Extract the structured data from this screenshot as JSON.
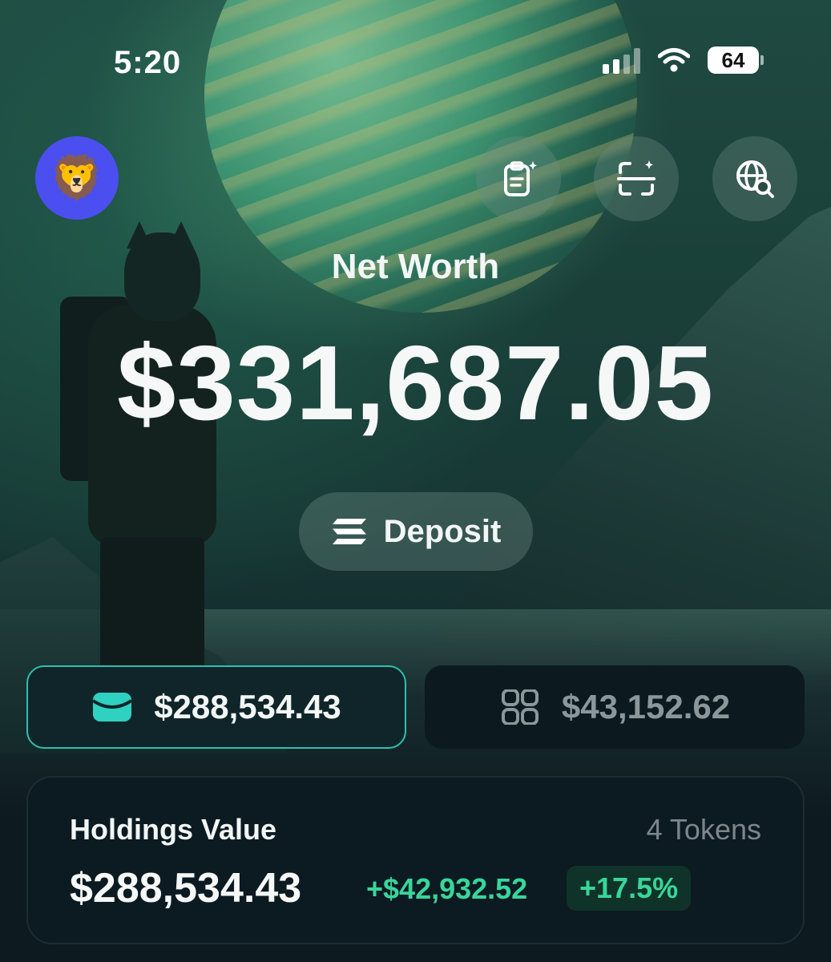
{
  "status_bar": {
    "time": "5:20",
    "battery": "64",
    "icons": [
      "cellular-signal-icon",
      "wifi-icon",
      "battery-icon"
    ]
  },
  "header": {
    "avatar_emoji": "🦁",
    "avatar_color": "#4b4ff0",
    "actions": [
      "clipboard-sparkle-icon",
      "scan-sparkle-icon",
      "globe-search-icon"
    ]
  },
  "net_worth": {
    "label": "Net Worth",
    "value": "$331,687.05"
  },
  "deposit": {
    "label": "Deposit",
    "icon": "solana-icon"
  },
  "balances": {
    "wallet": {
      "icon": "wallet-icon",
      "value": "$288,534.43",
      "accent": "#2fbfae",
      "selected": true
    },
    "other": {
      "icon": "grid-icon",
      "value": "$43,152.62",
      "selected": false
    }
  },
  "holdings": {
    "title": "Holdings Value",
    "token_count": "4 Tokens",
    "value": "$288,534.43",
    "change": "+$42,932.52",
    "change_pct": "+17.5%",
    "positive_color": "#39d59a"
  }
}
